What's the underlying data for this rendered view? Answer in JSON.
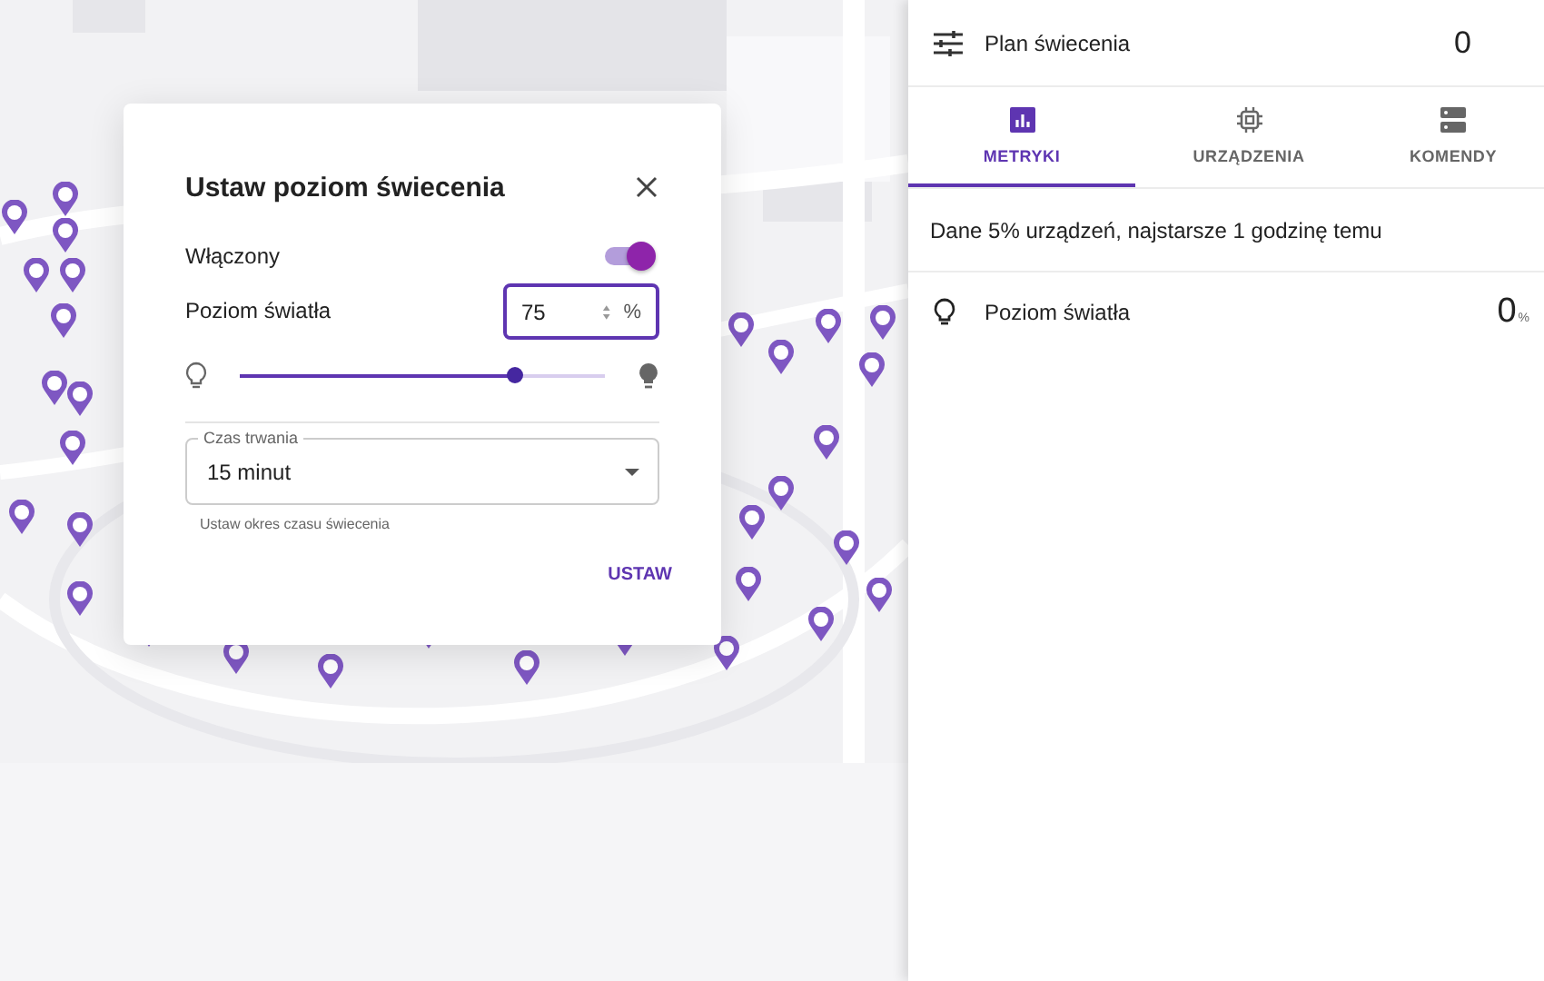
{
  "dialog": {
    "title": "Ustaw poziom świecenia",
    "enabled": {
      "label": "Włączony",
      "on": true
    },
    "light_level": {
      "label": "Poziom światła",
      "value": "75",
      "unit": "%",
      "level": 0.75
    },
    "duration": {
      "label": "Czas trwania",
      "value": "15 minut",
      "helper": "Ustaw okres czasu świecenia"
    },
    "submit": "USTAW"
  },
  "panel": {
    "header": {
      "title": "Plan świecenia",
      "count": "0"
    },
    "tabs": [
      {
        "label": "METRYKI",
        "kind": "chart",
        "selected": true
      },
      {
        "label": "URZĄDZENIA",
        "kind": "chip",
        "selected": false
      },
      {
        "label": "KOMENDY",
        "kind": "list",
        "selected": false
      }
    ],
    "info": "Dane 5% urządzeń, najstarsze 1 godzinę temu",
    "metrics": [
      {
        "label": "Poziom światła",
        "value": "0",
        "unit": "%"
      }
    ]
  }
}
